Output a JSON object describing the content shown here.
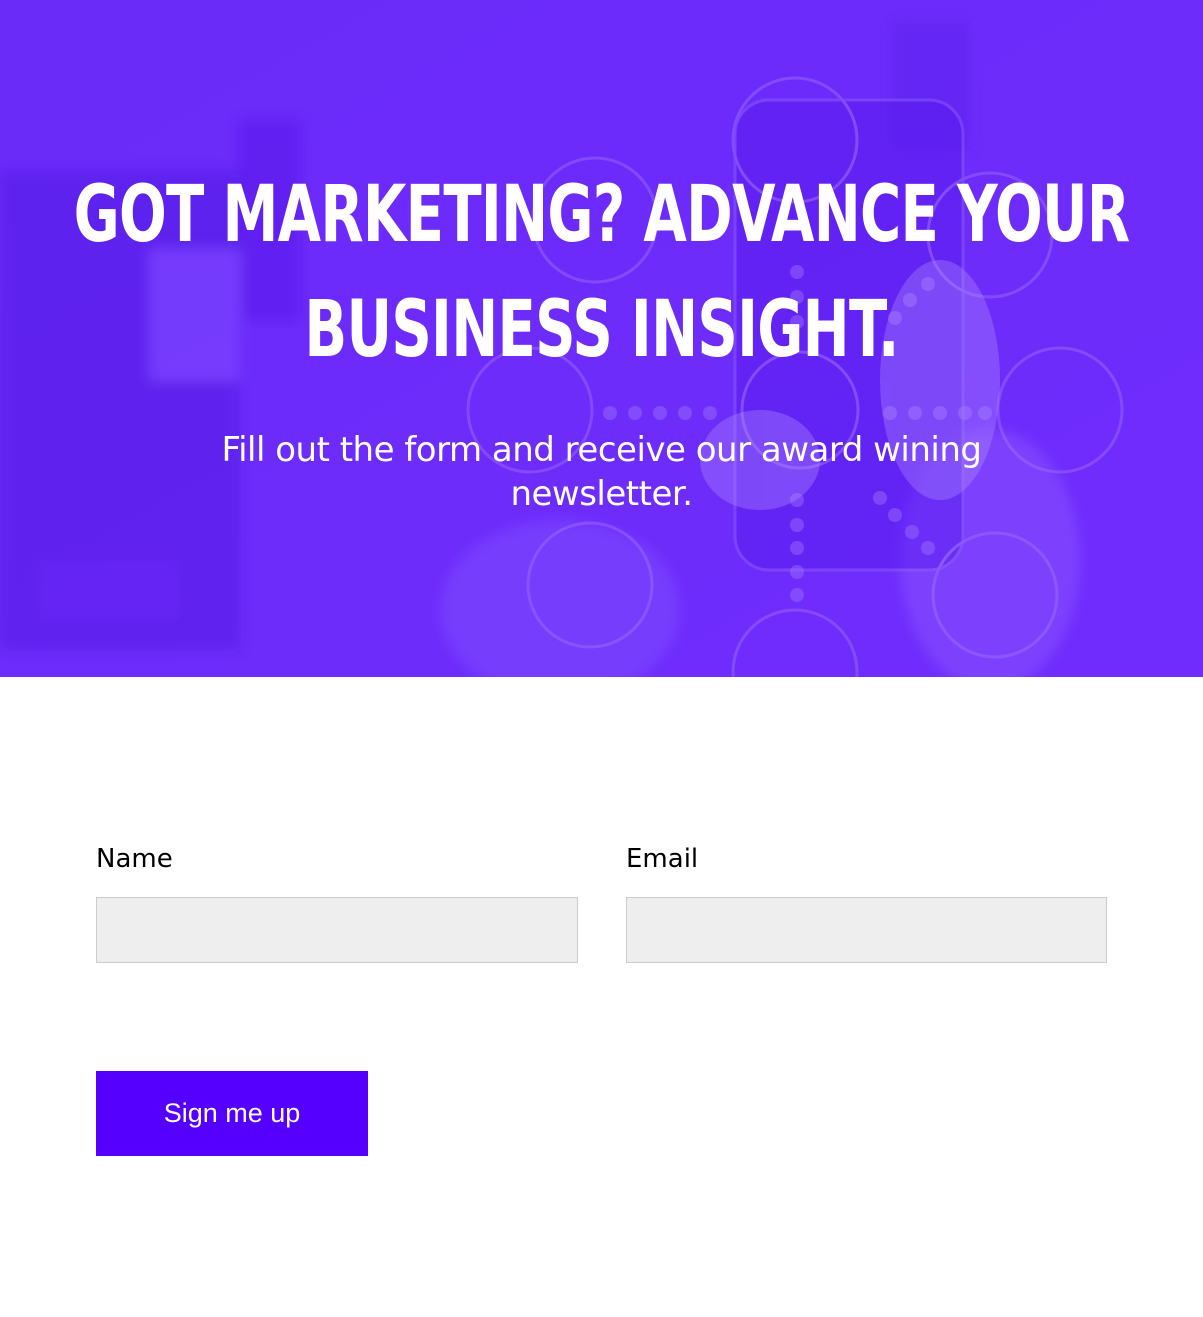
{
  "hero": {
    "title_line1": "Got Marketing? Advance Your",
    "title_line2": "Business Insight.",
    "subtitle": "Fill out the form and receive our award wining newsletter.",
    "overlay_color": "#6c2cf8"
  },
  "form": {
    "name_label": "Name",
    "name_value": "",
    "email_label": "Email",
    "email_value": "",
    "submit_label": "Sign me up",
    "button_color": "#5500ff",
    "input_bg": "#eeeeee"
  }
}
